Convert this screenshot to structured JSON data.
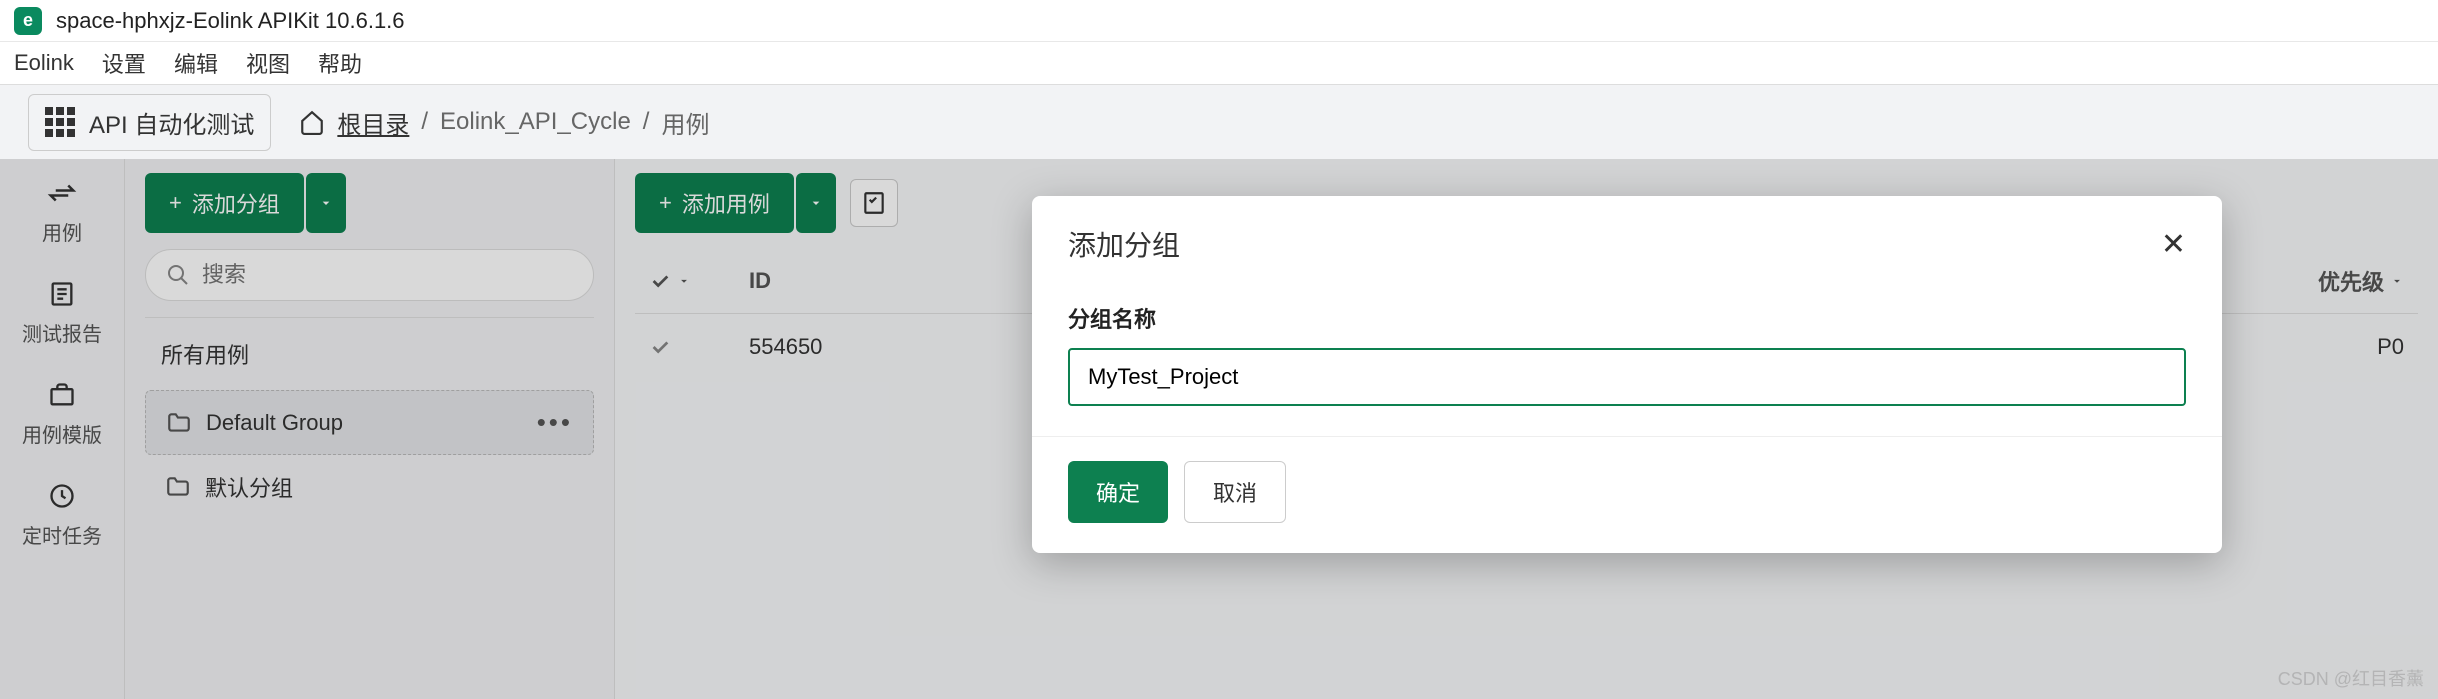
{
  "window": {
    "title": "space-hphxjz-Eolink APIKit 10.6.1.6"
  },
  "menubar": [
    "Eolink",
    "设置",
    "编辑",
    "视图",
    "帮助"
  ],
  "toolbar": {
    "section": "API 自动化测试",
    "root_label": "根目录",
    "breadcrumb": [
      "Eolink_API_Cycle",
      "用例"
    ]
  },
  "left_nav": [
    {
      "label": "用例"
    },
    {
      "label": "测试报告"
    },
    {
      "label": "用例模版"
    },
    {
      "label": "定时任务"
    }
  ],
  "sidebar": {
    "add_group_label": "添加分组",
    "search_placeholder": "搜索",
    "all_cases_label": "所有用例",
    "groups": [
      {
        "label": "Default Group",
        "active": true
      },
      {
        "label": "默认分组",
        "active": false
      }
    ]
  },
  "content": {
    "add_case_label": "添加用例",
    "columns": {
      "id": "ID",
      "priority": "优先级"
    },
    "rows": [
      {
        "id": "554650",
        "priority": "P0"
      }
    ]
  },
  "modal": {
    "title": "添加分组",
    "field_label": "分组名称",
    "field_value": "MyTest_Project",
    "confirm_label": "确定",
    "cancel_label": "取消"
  },
  "watermark": "CSDN @红目香薰"
}
